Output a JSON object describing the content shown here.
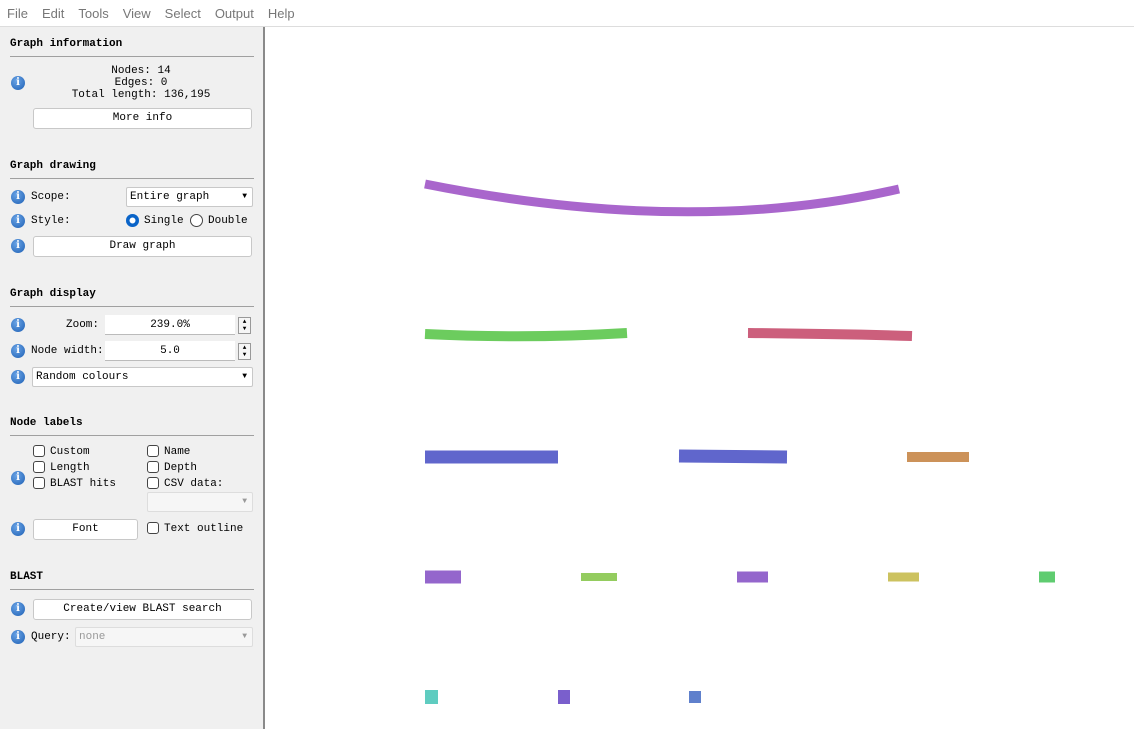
{
  "menu": [
    "File",
    "Edit",
    "Tools",
    "View",
    "Select",
    "Output",
    "Help"
  ],
  "graph_information": {
    "title": "Graph information",
    "nodes": "Nodes: 14",
    "edges": "Edges: 0",
    "total_length": "Total length: 136,195",
    "more_info": "More info"
  },
  "graph_drawing": {
    "title": "Graph drawing",
    "scope_label": "Scope:",
    "scope_value": "Entire graph",
    "style_label": "Style:",
    "style_single": "Single",
    "style_double": "Double",
    "style_selected": "Single",
    "draw_button": "Draw graph"
  },
  "graph_display": {
    "title": "Graph display",
    "zoom_label": "Zoom:",
    "zoom_value": "239.0%",
    "node_width_label": "Node width:",
    "node_width_value": "5.0",
    "colour_scheme": "Random colours"
  },
  "node_labels": {
    "title": "Node labels",
    "custom": "Custom",
    "name": "Name",
    "length": "Length",
    "depth": "Depth",
    "blast_hits": "BLAST hits",
    "csv_data": "CSV data:",
    "font_button": "Font",
    "text_outline": "Text outline"
  },
  "blast": {
    "title": "BLAST",
    "create_button": "Create/view BLAST search",
    "query_label": "Query:",
    "query_value": "none"
  },
  "graph_nodes_colors": [
    "#a966cc",
    "#6ccc5e",
    "#cc5f7c",
    "#6066cc",
    "#6066cc",
    "#cc9259",
    "#9466cc",
    "#94cc5f",
    "#9466cc",
    "#ccc25f",
    "#5fcc70",
    "#5fccc0",
    "#7a5fcc",
    "#5f80cc"
  ],
  "colors": {
    "info_icon": "#1d5fb4",
    "radio_selected": "#0a64c8"
  }
}
